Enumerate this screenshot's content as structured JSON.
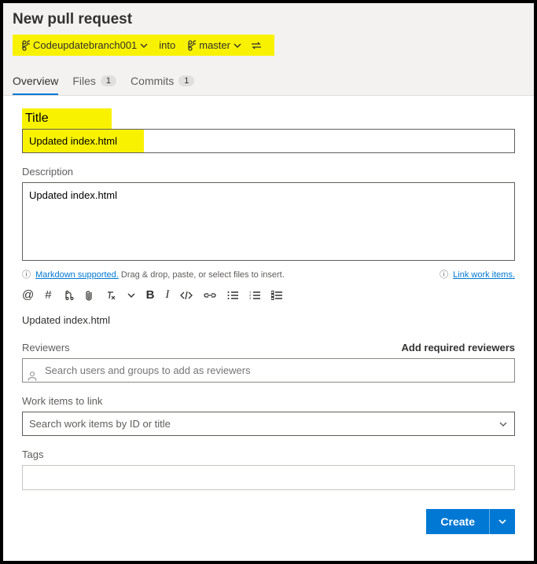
{
  "header": {
    "title": "New pull request",
    "sourceBranch": "Codeupdatebranch001",
    "into": "into",
    "targetBranch": "master"
  },
  "tabs": {
    "overview": "Overview",
    "files": "Files",
    "filesCount": "1",
    "commits": "Commits",
    "commitsCount": "1"
  },
  "form": {
    "titleLabel": "Title",
    "titleValue": "Updated index.html",
    "descLabel": "Description",
    "descValue": "Updated index.html",
    "mdSupported": "Markdown supported.",
    "mdHint": " Drag & drop, paste, or select files to insert.",
    "linkWorkItems": "Link work items.",
    "preview": "Updated index.html",
    "reviewersLabel": "Reviewers",
    "addRequired": "Add required reviewers",
    "reviewersPlaceholder": "Search users and groups to add as reviewers",
    "workItemsLabel": "Work items to link",
    "workItemsPlaceholder": "Search work items by ID or title",
    "tagsLabel": "Tags"
  },
  "footer": {
    "create": "Create"
  }
}
